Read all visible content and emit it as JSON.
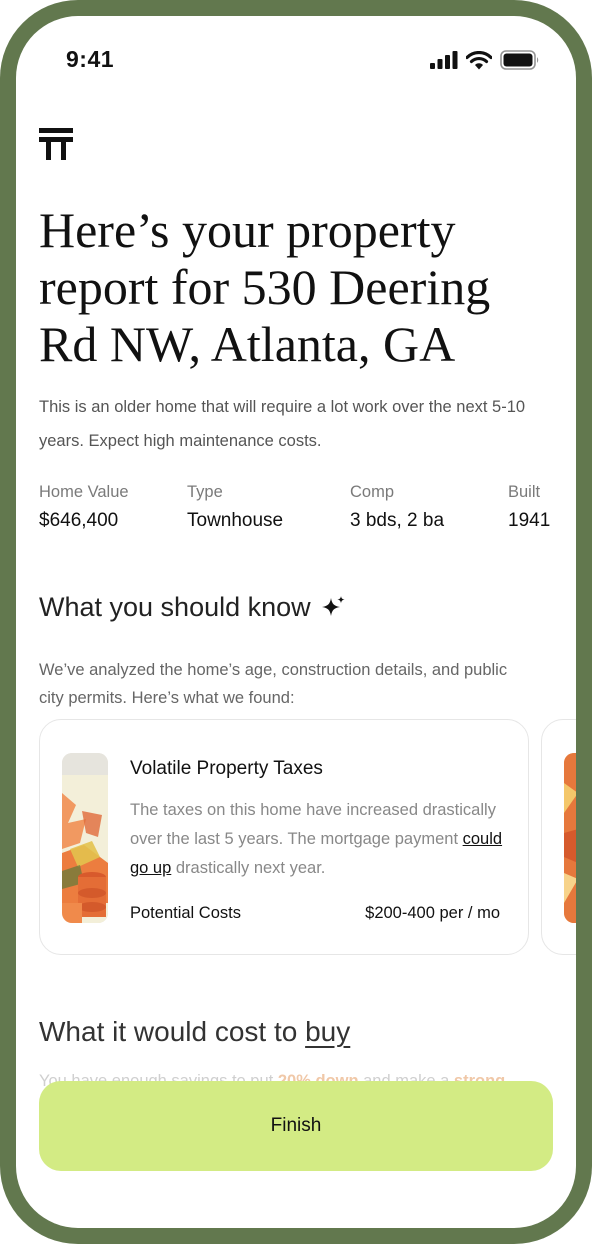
{
  "status_bar": {
    "time": "9:41"
  },
  "header": {
    "title": "Here’s your property report for 530 Deering Rd NW, Atlanta, GA",
    "description": "This is an older home that will require a lot work over the next 5-10 years. Expect high maintenance costs."
  },
  "stats": [
    {
      "label": "Home Value",
      "value": "$646,400"
    },
    {
      "label": "Type",
      "value": "Townhouse"
    },
    {
      "label": "Comp",
      "value": "3 bds, 2 ba"
    },
    {
      "label": "Built",
      "value": "1941"
    }
  ],
  "know_section": {
    "heading": "What you should know",
    "subtitle": "We’ve analyzed the home’s age, construction details, and public city permits. Here’s what we found:"
  },
  "cards": [
    {
      "title": "Volatile Property Taxes",
      "body_before": "The taxes on this home have increased drastically over the last 5 years. The mortgage payment ",
      "body_link": "could go up",
      "body_after": " drastically next year.",
      "cost_label": "Potential Costs",
      "cost_value": "$200-400 per / mo"
    }
  ],
  "cost_section": {
    "heading_prefix": "What it would cost to ",
    "heading_link": "buy",
    "fade_before": "You have enough savings to put ",
    "fade_bold1": "20% down",
    "fade_middle": " and make a ",
    "fade_bold2": "strong"
  },
  "footer": {
    "finish_label": "Finish"
  },
  "colors": {
    "frame": "#62784e",
    "accent_button": "#d3eb84"
  },
  "icons": {
    "logo": "brand-logo-icon",
    "sparkle": "sparkle-icon"
  }
}
